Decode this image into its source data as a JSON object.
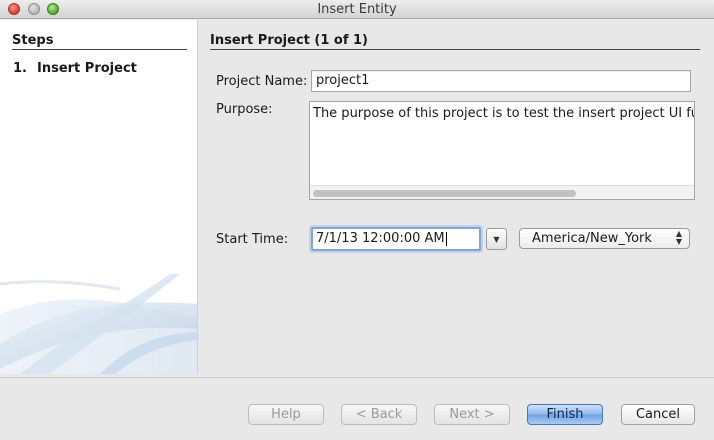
{
  "window": {
    "title": "Insert Entity"
  },
  "steps": {
    "header": "Steps",
    "items": [
      {
        "number": "1.",
        "label": "Insert Project"
      }
    ]
  },
  "form": {
    "section_title": "Insert Project (1 of 1)",
    "project_name_label": "Project Name:",
    "project_name_value": "project1",
    "purpose_label": "Purpose:",
    "purpose_value": "The purpose of this project is to test the insert project UI fur",
    "start_time_label": "Start Time:",
    "start_time_value": "7/1/13 12:00:00 AM",
    "timezone_value": "America/New_York"
  },
  "buttons": {
    "help": "Help",
    "back": "< Back",
    "next": "Next >",
    "finish": "Finish",
    "cancel": "Cancel"
  },
  "icons": {
    "close": "close-icon",
    "minimize": "minimize-icon",
    "maximize": "maximize-icon",
    "dropdown": "chevron-down-icon",
    "select_arrows": "updown-arrows-icon"
  },
  "colors": {
    "focus_ring": "#7aa7e0",
    "primary_button": "#8fb8ee"
  }
}
